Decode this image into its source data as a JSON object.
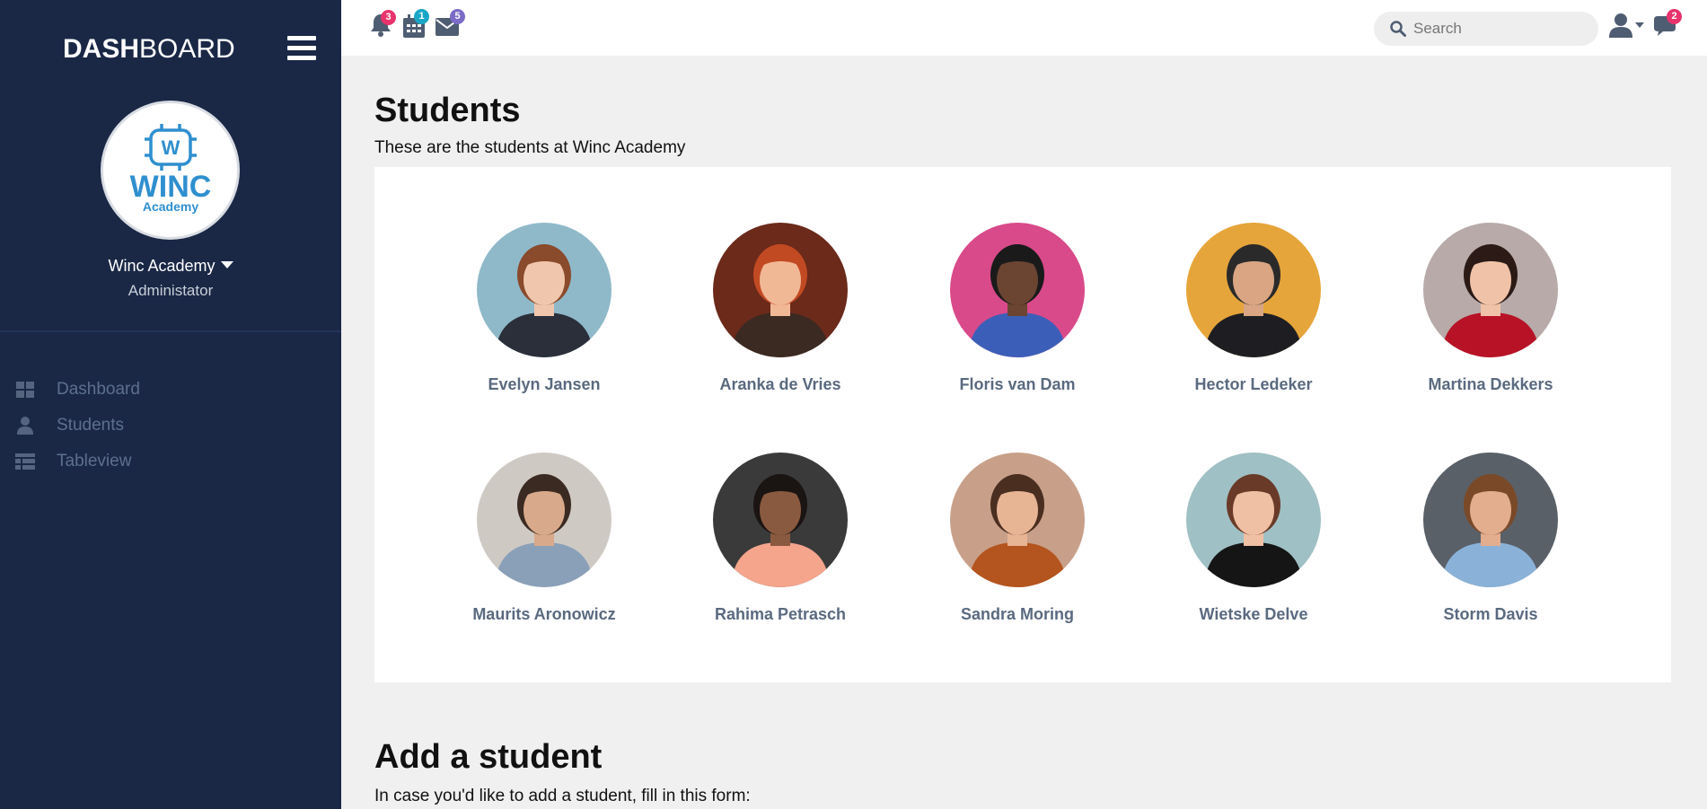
{
  "sidebar": {
    "brand_bold": "DASH",
    "brand_light": "BOARD",
    "logo_text_main": "WINC",
    "logo_text_sub": "Academy",
    "org_name": "Winc Academy",
    "org_role": "Administator",
    "nav": [
      {
        "label": "Dashboard",
        "icon": "dashboard-grid-icon"
      },
      {
        "label": "Students",
        "icon": "user-icon"
      },
      {
        "label": "Tableview",
        "icon": "table-icon"
      }
    ]
  },
  "topbar": {
    "notifications_badge": "3",
    "calendar_badge": "1",
    "mail_badge": "5",
    "chat_badge": "2",
    "search_placeholder": "Search"
  },
  "main": {
    "title": "Students",
    "subtitle": "These are the students at Winc Academy",
    "students": [
      {
        "name": "Evelyn Jansen",
        "bg": "#8fb9c9",
        "hair": "#8a4a2c",
        "skin": "#f0c7ad",
        "shirt": "#2a2f3a"
      },
      {
        "name": "Aranka de Vries",
        "bg": "#6b2a1a",
        "hair": "#c24a22",
        "skin": "#f1b896",
        "shirt": "#3a2a22"
      },
      {
        "name": "Floris van Dam",
        "bg": "#d94a8a",
        "hair": "#1a1a1a",
        "skin": "#6b4432",
        "shirt": "#3b5fb8"
      },
      {
        "name": "Hector Ledeker",
        "bg": "#e6a53a",
        "hair": "#2a2a2a",
        "skin": "#d9a583",
        "shirt": "#1e1e22"
      },
      {
        "name": "Martina Dekkers",
        "bg": "#b7aaa8",
        "hair": "#2b1a16",
        "skin": "#f0c3a8",
        "shirt": "#b81226"
      },
      {
        "name": "Maurits Aronowicz",
        "bg": "#cfc9c4",
        "hair": "#3a2a22",
        "skin": "#d8a98a",
        "shirt": "#8aa0b8"
      },
      {
        "name": "Rahima Petrasch",
        "bg": "#3a3a3a",
        "hair": "#1a1412",
        "skin": "#8a5a40",
        "shirt": "#f4a58c"
      },
      {
        "name": "Sandra Moring",
        "bg": "#c8a08a",
        "hair": "#4a2e20",
        "skin": "#e7b494",
        "shirt": "#b4541e"
      },
      {
        "name": "Wietske Delve",
        "bg": "#9fc0c4",
        "hair": "#6a3a28",
        "skin": "#f0c0a4",
        "shirt": "#151515"
      },
      {
        "name": "Storm Davis",
        "bg": "#5a6068",
        "hair": "#7a4a28",
        "skin": "#e2ae8e",
        "shirt": "#8ab2d8"
      }
    ],
    "add_title": "Add a student",
    "add_subtitle": "In case you'd like to add a student, fill in this form:"
  },
  "colors": {
    "sidebar_bg": "#1a2846",
    "badge_red": "#e8336d",
    "badge_cyan": "#1aa7c6",
    "badge_purple": "#7b6cc8",
    "logo_blue": "#2f8fcf"
  }
}
